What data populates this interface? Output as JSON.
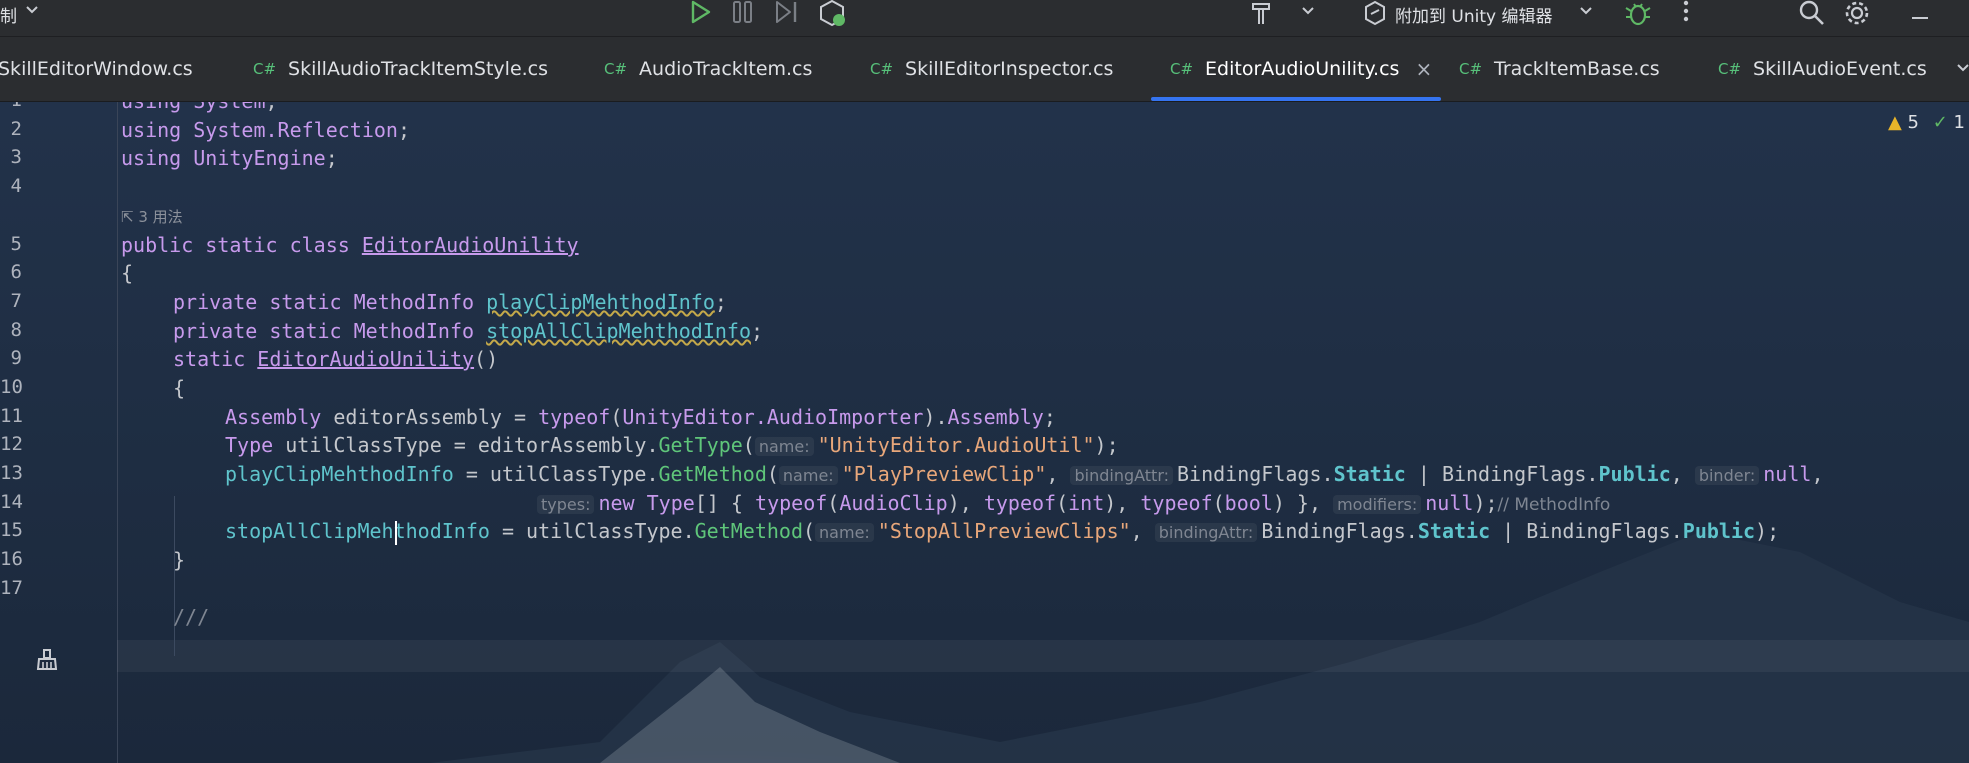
{
  "toolbar": {
    "left_label": "制",
    "attach_label": "附加到 Unity 编辑器"
  },
  "tabs": [
    {
      "lang": "",
      "name": "SkillEditorWindow.cs"
    },
    {
      "lang": "C#",
      "name": "SkillAudioTrackItemStyle.cs"
    },
    {
      "lang": "C#",
      "name": "AudioTrackItem.cs"
    },
    {
      "lang": "C#",
      "name": "SkillEditorInspector.cs"
    },
    {
      "lang": "C#",
      "name": "EditorAudioUnility.cs",
      "active": true
    },
    {
      "lang": "C#",
      "name": "TrackItemBase.cs"
    },
    {
      "lang": "C#",
      "name": "SkillAudioEvent.cs"
    }
  ],
  "tab_close": "×",
  "inspections": {
    "warnings": "5",
    "ok": "1"
  },
  "editor": {
    "usages": "3 用法",
    "line_numbers": [
      "1",
      "2",
      "3",
      "4",
      "5",
      "6",
      "7",
      "8",
      "9",
      "10",
      "11",
      "12",
      "13",
      "14",
      "15",
      "16",
      "17"
    ],
    "code": {
      "l1": {
        "kw": "using",
        "ns": "System",
        "tail": ";"
      },
      "l2": {
        "kw": "using",
        "ns": "System.Reflection",
        "tail": ";"
      },
      "l3": {
        "kw": "using",
        "ns": "UnityEngine",
        "tail": ";"
      },
      "l5": {
        "kw": "public static class",
        "cls": "EditorAudioUnility"
      },
      "l6": {
        "text": "{"
      },
      "l7": {
        "kw": "private static",
        "ty": "MethodInfo",
        "fld": "playClipMehthodInfo",
        "tail": ";"
      },
      "l8": {
        "kw": "private static",
        "ty": "MethodInfo",
        "fld": "stopAllClipMehthodInfo",
        "tail": ";"
      },
      "l9": {
        "kw": "static",
        "cls": "EditorAudioUnility",
        "tail": "()"
      },
      "l10": {
        "text": "{"
      },
      "l11": {
        "ty": "Assembly",
        "a": " editorAssembly = ",
        "kw": "typeof",
        "b": "(",
        "ns": "UnityEditor.AudioImporter",
        "c": ").",
        "fld": "Assembly",
        "tail": ";"
      },
      "l12": {
        "ty": "Type",
        "a": " utilClassType = editorAssembly.",
        "mth": "GetType",
        "b": "(",
        "hint": "name:",
        "str": "\"UnityEditor.AudioUtil\"",
        "tail": ");"
      },
      "l13": {
        "fld": "playClipMehthodInfo",
        "a": " = utilClassType.",
        "mth": "GetMethod",
        "b": "(",
        "hint1": "name:",
        "str": "\"PlayPreviewClip\"",
        "c": ", ",
        "hint2": "bindingAttr:",
        "bf1": "BindingFlags.",
        "s1": "Static",
        "pipe": " | ",
        "bf2": "BindingFlags.",
        "s2": "Public",
        "d": ", ",
        "hint3": "binder:",
        "kw": "null",
        "tail": ","
      },
      "l14": {
        "hint1": "types:",
        "kw1": "new",
        "ty": "Type",
        "a": "[] { ",
        "kw2": "typeof",
        "b": "(",
        "t1": "AudioClip",
        "c": "), ",
        "kw3": "typeof",
        "d": "(",
        "t2": "int",
        "e": "), ",
        "kw4": "typeof",
        "f": "(",
        "t3": "bool",
        "g": ") }, ",
        "hint2": "modifiers:",
        "kw5": "null",
        "tail": ");",
        "cmt": "// MethodInfo"
      },
      "l15": {
        "fld": "stopAllClipMehthodInfo",
        "a": " = utilClassType.",
        "mth": "GetMethod",
        "b": "(",
        "hint1": "name:",
        "str": "\"StopAllPreviewClips\"",
        "c": ", ",
        "hint2": "bindingAttr:",
        "bf1": "BindingFlags.",
        "s1": "Static",
        "pipe": " | ",
        "bf2": "BindingFlags.",
        "s2": "Public",
        "tail": ");"
      },
      "l16": {
        "text": "}"
      },
      "l18": {
        "text": "///"
      }
    }
  }
}
